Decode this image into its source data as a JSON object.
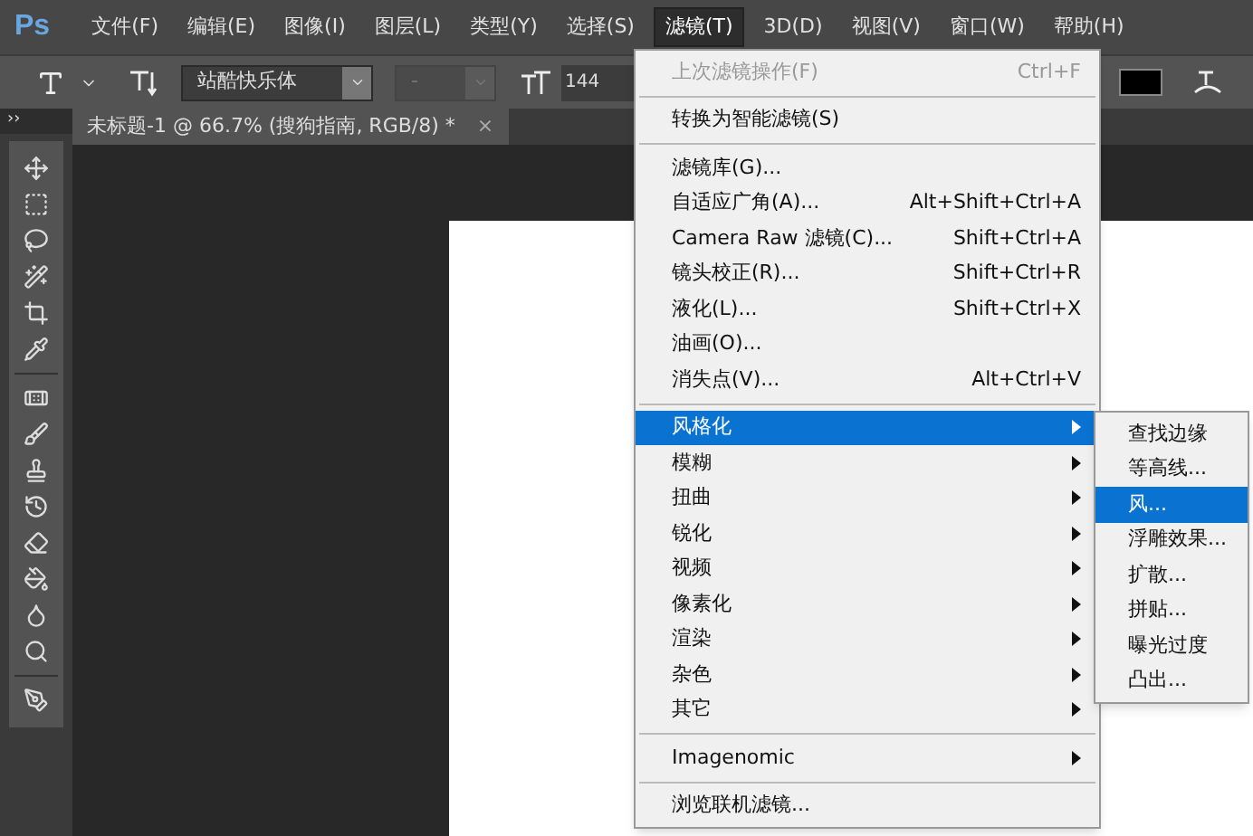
{
  "app_logo": "Ps",
  "menu_bar": [
    {
      "label": "文件(F)",
      "selected": false
    },
    {
      "label": "编辑(E)",
      "selected": false
    },
    {
      "label": "图像(I)",
      "selected": false
    },
    {
      "label": "图层(L)",
      "selected": false
    },
    {
      "label": "类型(Y)",
      "selected": false
    },
    {
      "label": "选择(S)",
      "selected": false
    },
    {
      "label": "滤镜(T)",
      "selected": true
    },
    {
      "label": "3D(D)",
      "selected": false
    },
    {
      "label": "视图(V)",
      "selected": false
    },
    {
      "label": "窗口(W)",
      "selected": false
    },
    {
      "label": "帮助(H)",
      "selected": false
    }
  ],
  "options_bar": {
    "font_family": "站酷快乐体",
    "font_style": "-",
    "font_size": "144"
  },
  "document_tab": {
    "title": "未标题-1 @ 66.7% (搜狗指南, RGB/8) *",
    "close": "×"
  },
  "panel_toggle": "››",
  "filter_menu": [
    {
      "kind": "item",
      "label": "上次滤镜操作(F)",
      "shortcut": "Ctrl+F",
      "disabled": true,
      "selected": false,
      "submenu": false
    },
    {
      "kind": "separator"
    },
    {
      "kind": "item",
      "label": "转换为智能滤镜(S)",
      "disabled": false,
      "selected": false,
      "submenu": false
    },
    {
      "kind": "separator"
    },
    {
      "kind": "item",
      "label": "滤镜库(G)...",
      "disabled": false,
      "selected": false,
      "submenu": false
    },
    {
      "kind": "item",
      "label": "自适应广角(A)...",
      "shortcut": "Alt+Shift+Ctrl+A",
      "disabled": false,
      "selected": false,
      "submenu": false
    },
    {
      "kind": "item",
      "label": "Camera Raw 滤镜(C)...",
      "shortcut": "Shift+Ctrl+A",
      "disabled": false,
      "selected": false,
      "submenu": false
    },
    {
      "kind": "item",
      "label": "镜头校正(R)...",
      "shortcut": "Shift+Ctrl+R",
      "disabled": false,
      "selected": false,
      "submenu": false
    },
    {
      "kind": "item",
      "label": "液化(L)...",
      "shortcut": "Shift+Ctrl+X",
      "disabled": false,
      "selected": false,
      "submenu": false
    },
    {
      "kind": "item",
      "label": "油画(O)...",
      "disabled": false,
      "selected": false,
      "submenu": false
    },
    {
      "kind": "item",
      "label": "消失点(V)...",
      "shortcut": "Alt+Ctrl+V",
      "disabled": false,
      "selected": false,
      "submenu": false
    },
    {
      "kind": "separator"
    },
    {
      "kind": "item",
      "label": "风格化",
      "disabled": false,
      "selected": true,
      "submenu": true
    },
    {
      "kind": "item",
      "label": "模糊",
      "disabled": false,
      "selected": false,
      "submenu": true
    },
    {
      "kind": "item",
      "label": "扭曲",
      "disabled": false,
      "selected": false,
      "submenu": true
    },
    {
      "kind": "item",
      "label": "锐化",
      "disabled": false,
      "selected": false,
      "submenu": true
    },
    {
      "kind": "item",
      "label": "视频",
      "disabled": false,
      "selected": false,
      "submenu": true
    },
    {
      "kind": "item",
      "label": "像素化",
      "disabled": false,
      "selected": false,
      "submenu": true
    },
    {
      "kind": "item",
      "label": "渲染",
      "disabled": false,
      "selected": false,
      "submenu": true
    },
    {
      "kind": "item",
      "label": "杂色",
      "disabled": false,
      "selected": false,
      "submenu": true
    },
    {
      "kind": "item",
      "label": "其它",
      "disabled": false,
      "selected": false,
      "submenu": true
    },
    {
      "kind": "separator"
    },
    {
      "kind": "item",
      "label": "Imagenomic",
      "disabled": false,
      "selected": false,
      "submenu": true
    },
    {
      "kind": "separator"
    },
    {
      "kind": "item",
      "label": "浏览联机滤镜...",
      "disabled": false,
      "selected": false,
      "submenu": false
    }
  ],
  "stylize_submenu": [
    {
      "label": "查找边缘",
      "selected": false
    },
    {
      "label": "等高线...",
      "selected": false
    },
    {
      "label": "风...",
      "selected": true
    },
    {
      "label": "浮雕效果...",
      "selected": false
    },
    {
      "label": "扩散...",
      "selected": false
    },
    {
      "label": "拼贴...",
      "selected": false
    },
    {
      "label": "曝光过度",
      "selected": false
    },
    {
      "label": "凸出...",
      "selected": false
    }
  ]
}
